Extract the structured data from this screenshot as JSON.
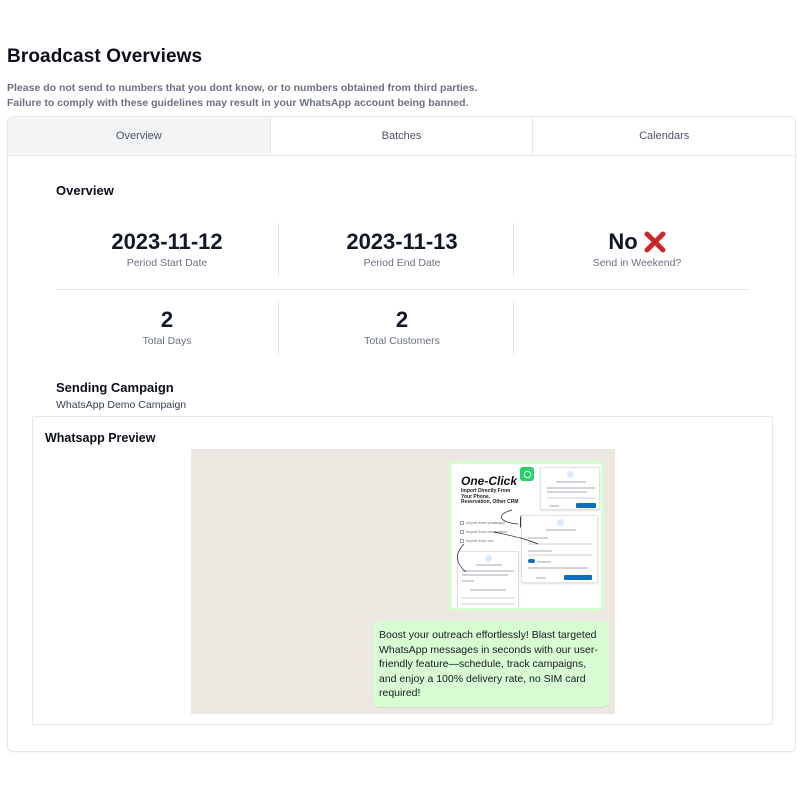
{
  "page": {
    "title": "Broadcast Overviews",
    "notice_line1": "Please do not send to numbers that you dont know, or to numbers obtained from third parties.",
    "notice_line2": "Failure to comply with these guidelines may result in your WhatsApp account being banned."
  },
  "tabs": [
    {
      "label": "Overview",
      "active": true
    },
    {
      "label": "Batches",
      "active": false
    },
    {
      "label": "Calendars",
      "active": false
    }
  ],
  "overview": {
    "title": "Overview",
    "period_start": {
      "value": "2023-11-12",
      "label": "Period Start Date"
    },
    "period_end": {
      "value": "2023-11-13",
      "label": "Period End Date"
    },
    "weekend": {
      "value": "No",
      "label": "Send in Weekend?",
      "icon": "cross-mark-icon",
      "icon_color": "#dc2626"
    },
    "total_days": {
      "value": "2",
      "label": "Total Days"
    },
    "total_customers": {
      "value": "2",
      "label": "Total Customers"
    }
  },
  "campaign": {
    "title": "Sending Campaign",
    "name": "WhatsApp Demo Campaign"
  },
  "preview": {
    "title": "Whatsapp Preview",
    "image": {
      "headline": "One-Click",
      "subheadline": "Import Directly From Your Phone, Reservation, Other CRM",
      "options": [
        "Import from whatsapp",
        "Import from reservation",
        "Import from csv"
      ]
    },
    "message": "Boost your outreach effortlessly! Blast targeted WhatsApp messages in seconds with our user-friendly feature—schedule, track campaigns, and enjoy a 100% delivery rate, no SIM card required!"
  },
  "colors": {
    "bubble": "#d9fdd3",
    "chat_bg": "#ece8e1",
    "whatsapp_green": "#25d366",
    "active_tab": "#f3f4f6"
  }
}
